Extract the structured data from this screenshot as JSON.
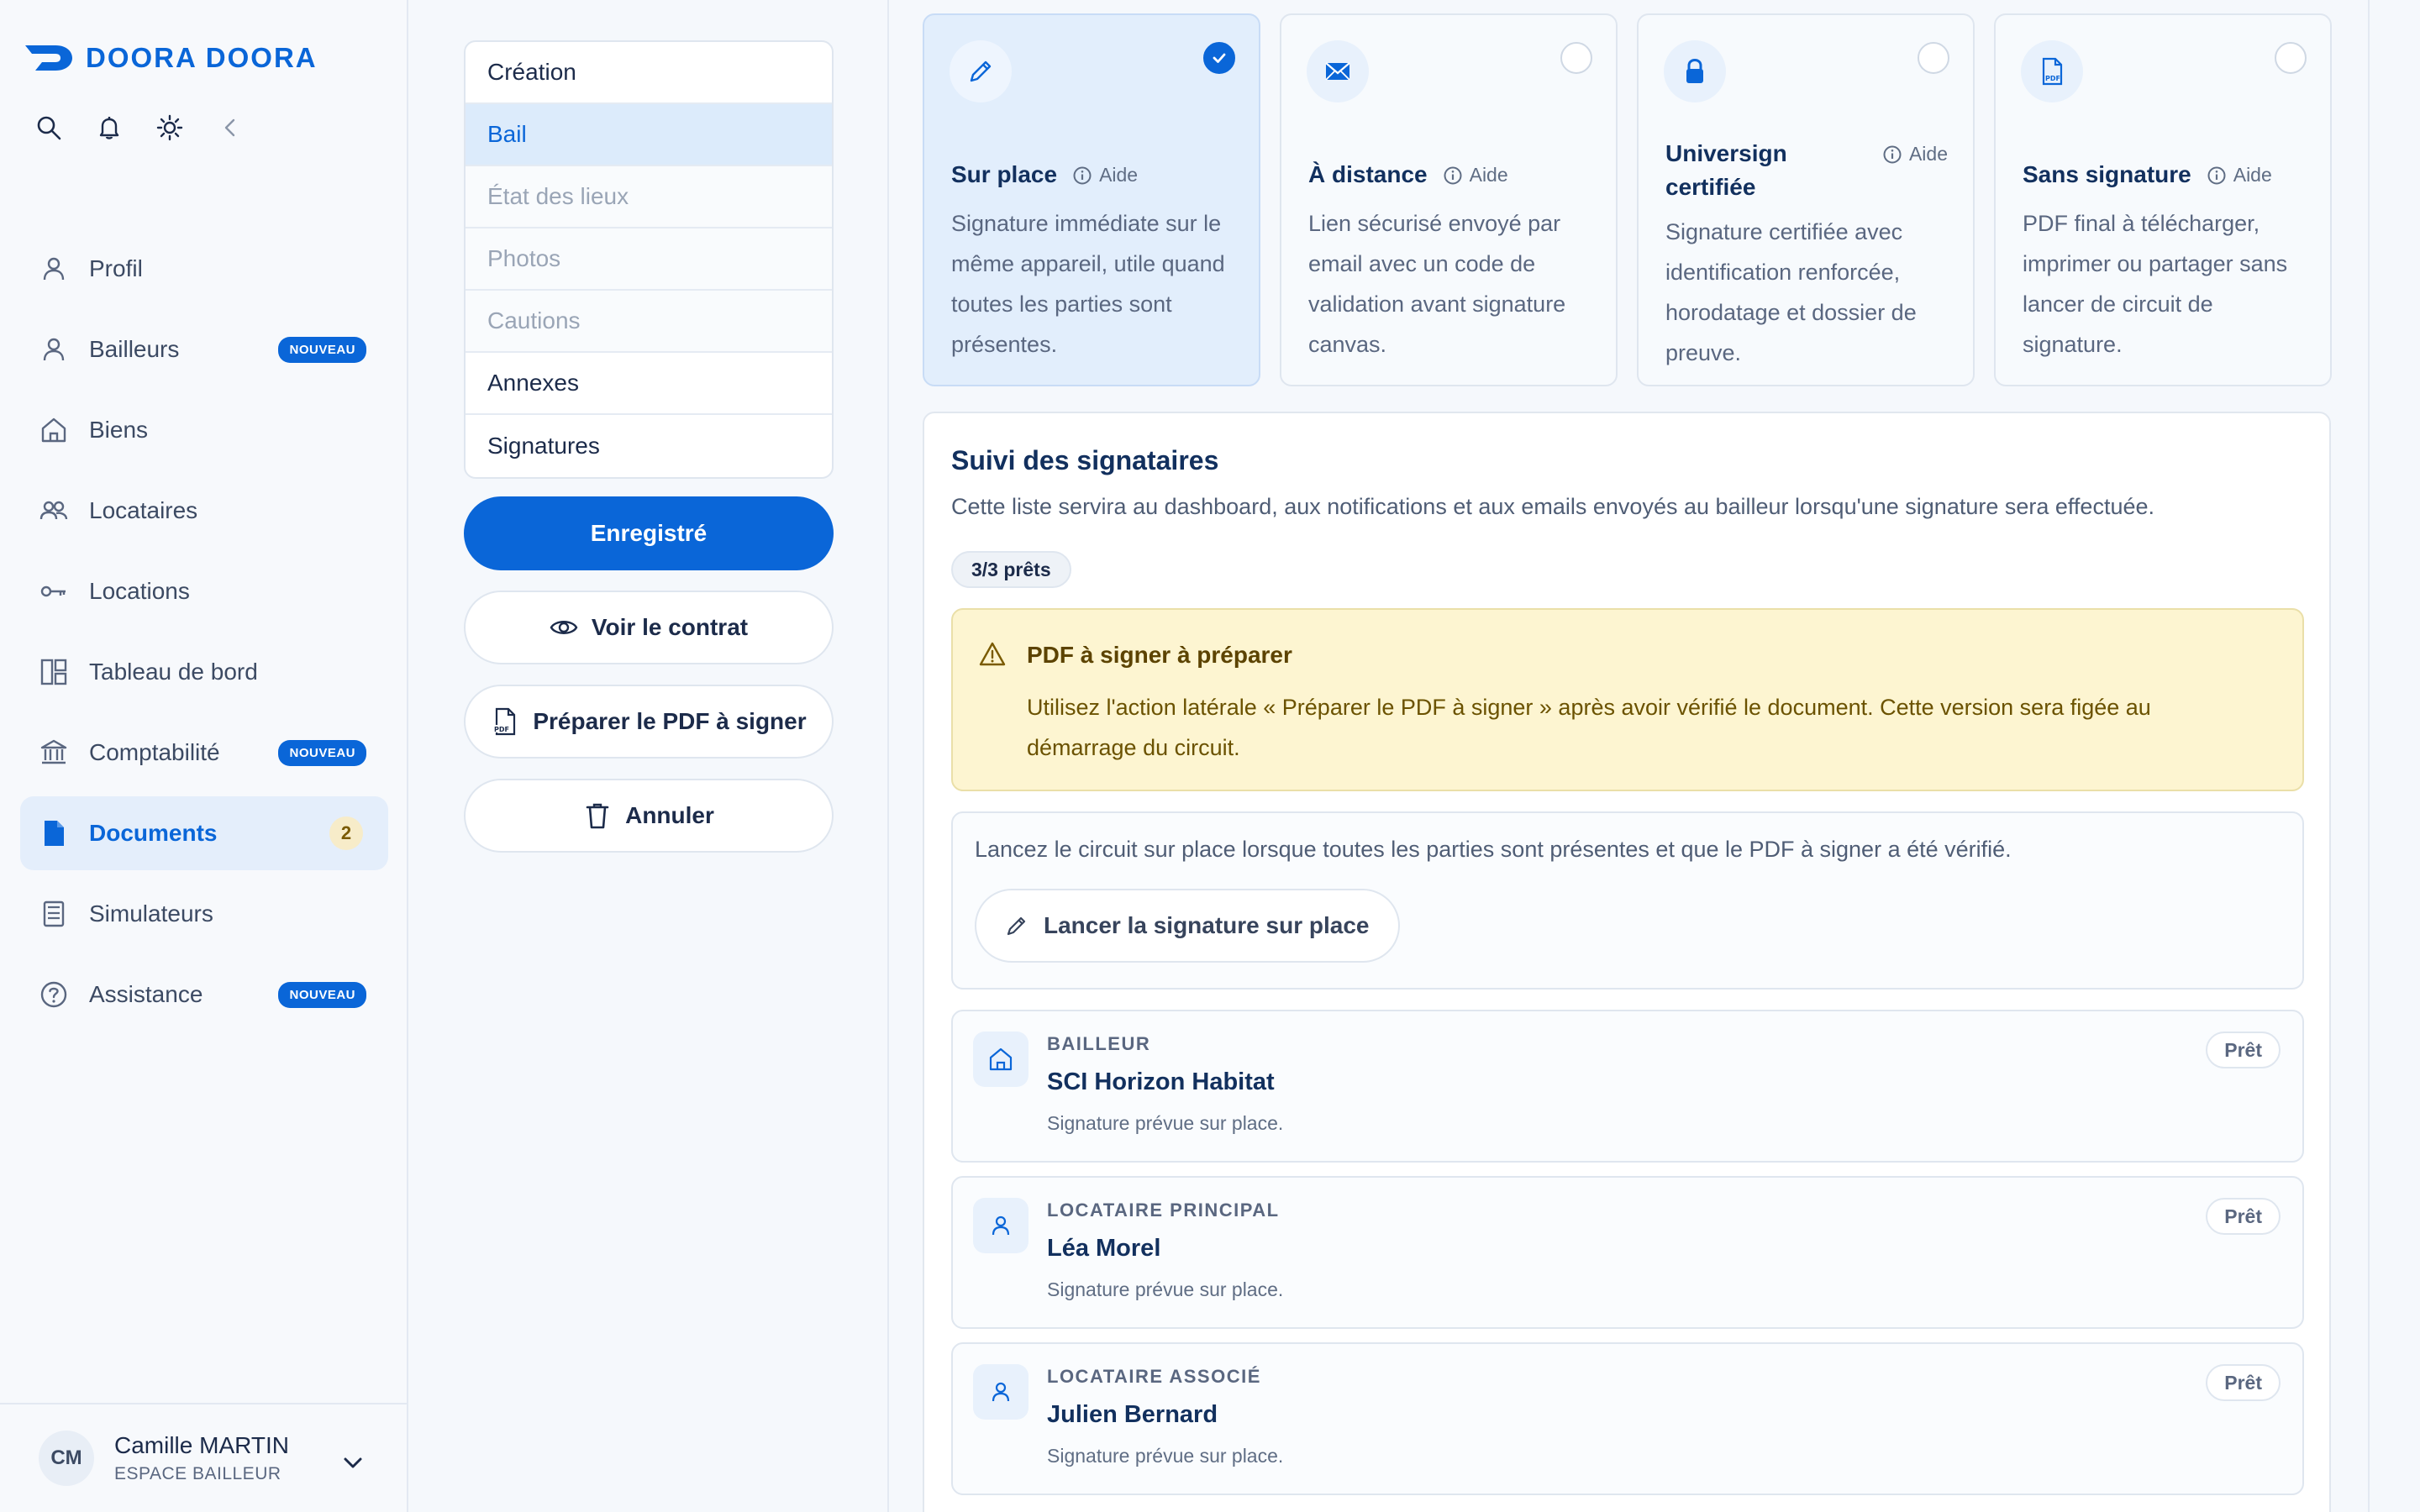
{
  "brand": {
    "name": "DOORA DOORA",
    "color": "#0a66d8"
  },
  "topbar": {
    "icons": [
      "search-icon",
      "bell-icon",
      "sun-icon",
      "collapse-icon"
    ]
  },
  "sidebar": {
    "items": [
      {
        "label": "Profil",
        "icon": "user-icon"
      },
      {
        "label": "Bailleurs",
        "icon": "user-icon",
        "badge": "NOUVEAU"
      },
      {
        "label": "Biens",
        "icon": "home-icon"
      },
      {
        "label": "Locataires",
        "icon": "users-icon"
      },
      {
        "label": "Locations",
        "icon": "key-icon"
      },
      {
        "label": "Tableau de bord",
        "icon": "dashboard-icon"
      },
      {
        "label": "Comptabilité",
        "icon": "bank-icon",
        "badge": "NOUVEAU"
      },
      {
        "label": "Documents",
        "icon": "document-icon",
        "count": "2",
        "active": true
      },
      {
        "label": "Simulateurs",
        "icon": "calculator-icon"
      },
      {
        "label": "Assistance",
        "icon": "help-icon",
        "badge": "NOUVEAU"
      }
    ]
  },
  "user": {
    "initials": "CM",
    "name": "Camille MARTIN",
    "role": "ESPACE BAILLEUR"
  },
  "steps": [
    {
      "label": "Création",
      "state": "normal"
    },
    {
      "label": "Bail",
      "state": "selected"
    },
    {
      "label": "État des lieux",
      "state": "disabled"
    },
    {
      "label": "Photos",
      "state": "disabled"
    },
    {
      "label": "Cautions",
      "state": "disabled"
    },
    {
      "label": "Annexes",
      "state": "normal"
    },
    {
      "label": "Signatures",
      "state": "normal"
    }
  ],
  "actions": {
    "save": "Enregistré",
    "view": "Voir le contrat",
    "prepare": "Préparer le PDF à signer",
    "cancel": "Annuler"
  },
  "modes": [
    {
      "title": "Sur place",
      "aide": "Aide",
      "desc": "Signature immédiate sur le même appareil, utile quand toutes les parties sont présentes.",
      "icon": "pencil-icon",
      "selected": true
    },
    {
      "title": "À distance",
      "aide": "Aide",
      "desc": "Lien sécurisé envoyé par email avec un code de validation avant signature canvas.",
      "icon": "mail-icon",
      "selected": false
    },
    {
      "title": "Universign certifiée",
      "aide": "Aide",
      "desc": "Signature certifiée avec identification renforcée, horodatage et dossier de preuve.",
      "icon": "lock-icon",
      "selected": false
    },
    {
      "title": "Sans signature",
      "aide": "Aide",
      "desc": "PDF final à télécharger, imprimer ou partager sans lancer de circuit de signature.",
      "icon": "pdf-icon",
      "selected": false
    }
  ],
  "tracking": {
    "title": "Suivi des signataires",
    "subtitle": "Cette liste servira au dashboard, aux notifications et aux emails envoyés au bailleur lorsqu'une signature sera effectuée.",
    "ready_chip": "3/3 prêts",
    "warning": {
      "title": "PDF à signer à préparer",
      "text": "Utilisez l'action latérale « Préparer le PDF à signer » après avoir vérifié le document. Cette version sera figée au démarrage du circuit."
    },
    "launch": {
      "text": "Lancez le circuit sur place lorsque toutes les parties sont présentes et que le PDF à signer a été vérifié.",
      "button": "Lancer la signature sur place"
    },
    "signers": [
      {
        "role": "BAILLEUR",
        "name": "SCI Horizon Habitat",
        "note": "Signature prévue sur place.",
        "status": "Prêt",
        "icon": "home-icon"
      },
      {
        "role": "LOCATAIRE PRINCIPAL",
        "name": "Léa Morel",
        "note": "Signature prévue sur place.",
        "status": "Prêt",
        "icon": "user-icon"
      },
      {
        "role": "LOCATAIRE ASSOCIÉ",
        "name": "Julien Bernard",
        "note": "Signature prévue sur place.",
        "status": "Prêt",
        "icon": "user-icon"
      }
    ]
  }
}
